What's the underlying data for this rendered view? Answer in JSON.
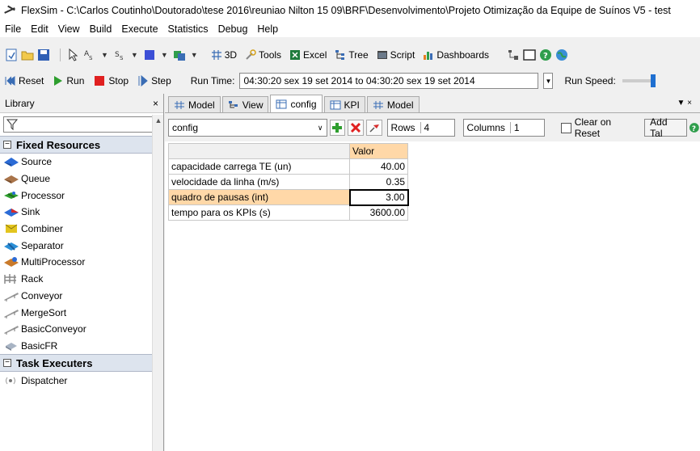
{
  "window": {
    "title": "FlexSim - C:\\Carlos Coutinho\\Doutorado\\tese 2016\\reuniao Nilton 15 09\\BRF\\Desenvolvimento\\Projeto Otimização da Equipe de Suínos V5 - test"
  },
  "menu": [
    "File",
    "Edit",
    "View",
    "Build",
    "Execute",
    "Statistics",
    "Debug",
    "Help"
  ],
  "toolbar": {
    "btn_3d": "3D",
    "btn_tools": "Tools",
    "btn_excel": "Excel",
    "btn_tree": "Tree",
    "btn_script": "Script",
    "btn_dashboards": "Dashboards"
  },
  "runbar": {
    "reset": "Reset",
    "run": "Run",
    "stop": "Stop",
    "step": "Step",
    "run_time_label": "Run Time:",
    "run_time_value": "04:30:20  sex 19 set 2014  to  04:30:20  sex 19 set 2014",
    "run_speed_label": "Run Speed:",
    "run_speed_fraction": 0.95
  },
  "library": {
    "title": "Library",
    "close": "×",
    "filter_placeholder": "",
    "sections": [
      {
        "name": "Fixed Resources",
        "items": [
          "Source",
          "Queue",
          "Processor",
          "Sink",
          "Combiner",
          "Separator",
          "MultiProcessor",
          "Rack",
          "Conveyor",
          "MergeSort",
          "BasicConveyor",
          "BasicFR"
        ]
      },
      {
        "name": "Task Executers",
        "items": [
          "Dispatcher"
        ]
      }
    ]
  },
  "tabs": [
    "Model",
    "View",
    "config",
    "KPI",
    "Model"
  ],
  "active_tab": "config",
  "table_editor": {
    "table_name": "config",
    "rows_label": "Rows",
    "rows_value": "4",
    "columns_label": "Columns",
    "columns_value": "1",
    "clear_on_reset": "Clear on Reset",
    "add_table": "Add Tal",
    "column_header": "Valor",
    "rows": [
      {
        "label": "capacidade carrega TE (un)",
        "value": "40.00"
      },
      {
        "label": "velocidade da linha (m/s)",
        "value": "0.35"
      },
      {
        "label": "quadro de pausas (int)",
        "value": "3.00"
      },
      {
        "label": "tempo para os KPIs (s)",
        "value": "3600.00"
      }
    ],
    "selected_row": 2
  },
  "colors": {
    "accent_header": "#ffd8a8",
    "run_green": "#2e9e2e",
    "stop_red": "#e02020",
    "speed_blue": "#1f6fd0"
  }
}
